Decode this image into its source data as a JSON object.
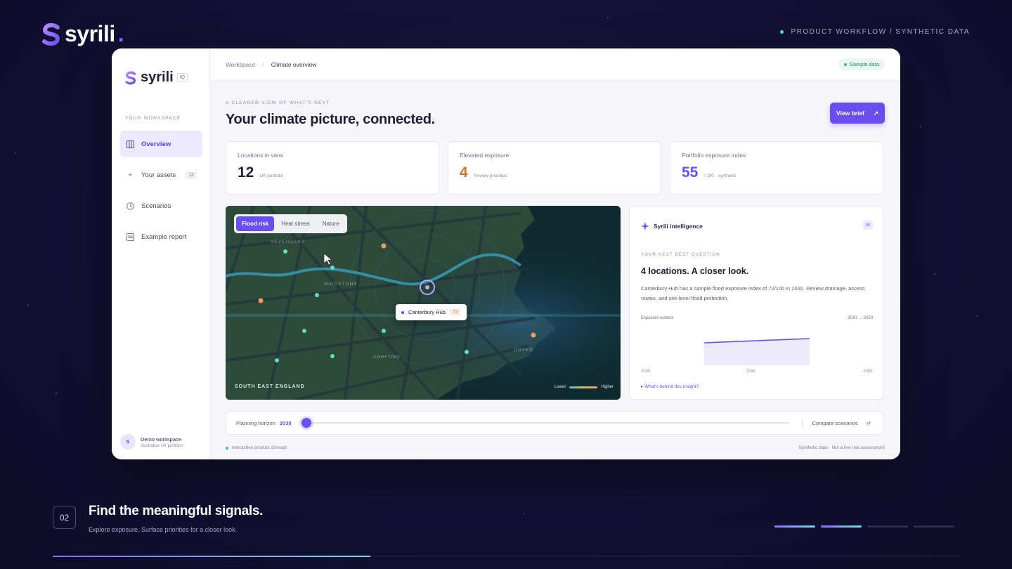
{
  "brand": {
    "name": "syrili",
    "dot": "."
  },
  "top_tag": "PRODUCT WORKFLOW / SYNTHETIC DATA",
  "app": {
    "logo": {
      "name": "syrili",
      "badge": "IQ"
    },
    "sidebar": {
      "section": "YOUR WORKSPACE",
      "items": [
        {
          "label": "Overview",
          "icon": "columns-icon",
          "active": true
        },
        {
          "label": "Your assets",
          "icon": "pin-icon",
          "count": "12"
        },
        {
          "label": "Scenarios",
          "icon": "clock-icon"
        },
        {
          "label": "Example report",
          "icon": "report-icon"
        }
      ],
      "workspace": {
        "avatar": "S",
        "name": "Demo workspace",
        "sub": "Illustrative UK portfolio"
      }
    },
    "breadcrumb": {
      "root": "Workspace",
      "sep": "/",
      "current": "Climate overview"
    },
    "status_pill": "Sample data",
    "eyebrow": "A CLEARER VIEW OF WHAT'S NEXT",
    "headline": "Your climate picture, connected.",
    "view_brief": "View brief",
    "view_brief_icon": "↗",
    "cards": [
      {
        "label": "Locations in view",
        "value": "12",
        "sub": "UK portfolio",
        "color": "#23223a"
      },
      {
        "label": "Elevated exposure",
        "value": "4",
        "sub": "Review priorities",
        "color": "#c7742c"
      },
      {
        "label": "Portfolio exposure index",
        "value": "55",
        "sub": "/ 100 · synthetic",
        "color": "#6a4ef0"
      }
    ],
    "map": {
      "tabs": [
        "Flood risk",
        "Heat stress",
        "Nature"
      ],
      "active_tab": "Flood risk",
      "towns": [
        "SEVENOAKS",
        "MAIDSTONE",
        "ASHFORD",
        "DOVER"
      ],
      "tooltip": {
        "name": "Canterbury Hub",
        "score": "72"
      },
      "region": "SOUTH EAST ENGLAND",
      "legend": {
        "low": "Lower",
        "high": "Higher"
      }
    },
    "intel": {
      "title": "Syrili intelligence",
      "badge": "AI",
      "question_label": "YOUR NEXT BEST QUESTION",
      "headline": "4 locations. A closer look.",
      "body": "Canterbury Hub has a sample flood exposure index of 72/100 in 2030. Review drainage, access routes, and site-level flood protection.",
      "outlook_label": "Exposure outlook",
      "outlook_range": "2030 → 2050",
      "ticks": [
        "2030",
        "2040",
        "2050"
      ],
      "link": "▸ What's behind this insight?"
    },
    "slider": {
      "label": "Planning horizon",
      "year": "2030",
      "progress": 0,
      "compare": "Compare scenarios",
      "compare_icon": "⇄"
    },
    "footer_left": "Interactive product concept",
    "footer_right": "Synthetic data · Not a live risk assessment"
  },
  "slide": {
    "step": "02",
    "title": "Find the meaningful signals.",
    "subtitle": "Explore exposure. Surface priorities for a closer look.",
    "pager_total": 4,
    "pager_active": 2
  },
  "colors": {
    "accent": "#6a4ef0",
    "bg": "#141238",
    "teal": "#54e0c8",
    "orange": "#f09a5b"
  }
}
